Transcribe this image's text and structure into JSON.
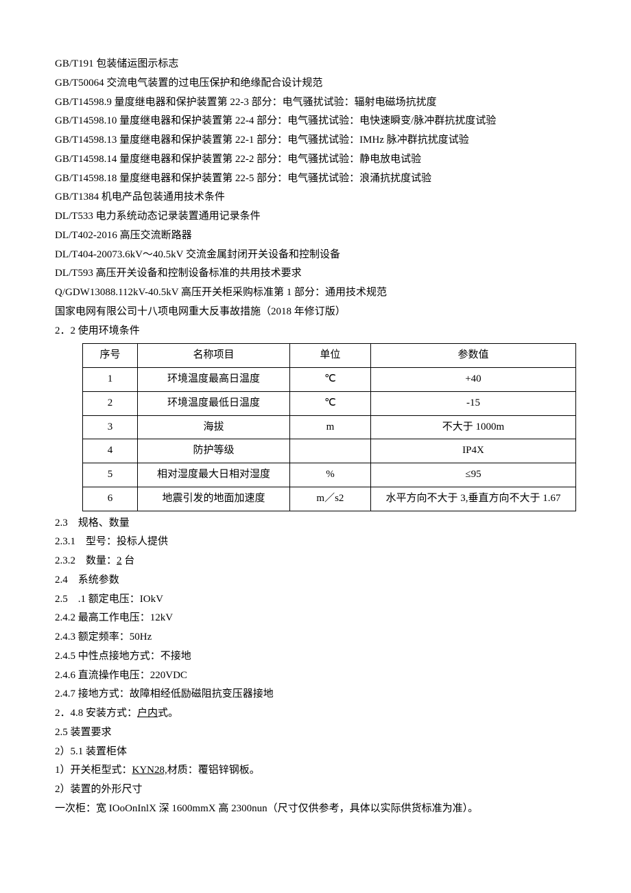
{
  "standards": [
    "GB/T191 包装储运图示标志",
    "GB/T50064 交流电气装置的过电压保护和绝缘配合设计规范",
    "GB/T14598.9 量度继电器和保护装置第 22-3 部分：电气骚扰试验：辐射电磁场抗扰度",
    "GB/T14598.10 量度继电器和保护装置第 22-4 部分：电气骚扰试验：电快速瞬变/脉冲群抗扰度试验",
    "GB/T14598.13 量度继电器和保护装置第 22-1 部分：电气骚扰试验：IMHz 脉冲群抗扰度试验",
    "GB/T14598.14 量度继电器和保护装置第 22-2 部分：电气骚扰试验：静电放电试验",
    "GB/T14598.18 量度继电器和保护装置第 22-5 部分：电气骚扰试验：浪涌抗扰度试验",
    "GB/T1384 机电产品包装通用技术条件",
    "DL/T533 电力系统动态记录装置通用记录条件",
    "DL/T402-2016 高压交流断路器",
    "DL/T404-20073.6kV～40.5kV 交流金属封闭开关设备和控制设备",
    "DL/T593 高压开关设备和控制设备标准的共用技术要求",
    "Q/GDW13088.112kV-40.5kV 高压开关柜采购标准第 1 部分：通用技术规范",
    "国家电网有限公司十八项电网重大反事故措施（2018 年修订版）"
  ],
  "section_2_2": "2．2 使用环境条件",
  "table_headers": {
    "c1": "序号",
    "c2": "名称项目",
    "c3": "单位",
    "c4": "参数值"
  },
  "env_rows": [
    {
      "no": "1",
      "item": "环境温度最高日温度",
      "unit": "℃",
      "value": "+40"
    },
    {
      "no": "2",
      "item": "环境温度最低日温度",
      "unit": "℃",
      "value": "-15"
    },
    {
      "no": "3",
      "item": "海拔",
      "unit": "m",
      "value": "不大于 1000m"
    },
    {
      "no": "4",
      "item": "防护等级",
      "unit": "",
      "value": "IP4X"
    },
    {
      "no": "5",
      "item": "相对湿度最大日相对湿度",
      "unit": "%",
      "value": "≤95"
    },
    {
      "no": "6",
      "item": "地震引发的地面加速度",
      "unit": "m／s2",
      "value": "水平方向不大于 3,垂直方向不大于 1.67"
    }
  ],
  "lines": {
    "l23": "2.3　规格、数量",
    "l231": "2.3.1　型号：投标人提供",
    "l232a": "2.3.2　数量：",
    "l232b": "2",
    "l232c": " 台",
    "l24": "2.4　系统参数",
    "l25": "2.5　.1 额定电压：IOkV",
    "l242": "2.4.2 最高工作电压：12kV",
    "l243": "2.4.3 额定频率：50Hz",
    "l245": "2.4.5 中性点接地方式：不接地",
    "l246": "2.4.6 直流操作电压：220VDC",
    "l247": "2.4.7 接地方式：故障相经低励磁阻抗变压器接地",
    "l248a": "2．4.8 安装方式：",
    "l248b": "户内",
    "l248c": "式。",
    "l25t": "2.5 装置要求",
    "l251": "2）5.1 装置柜体",
    "l251_1a": "1）开关柜型式：",
    "l251_1b": "KYN28,",
    "l251_1c": "材质：覆铝锌钢板。",
    "l251_2": "2）装置的外形尺寸",
    "dim": "一次柜：宽 IOoOnInlX 深 1600mmX 高 2300nun（尺寸仅供参考，具体以实际供货标准为准）。"
  }
}
